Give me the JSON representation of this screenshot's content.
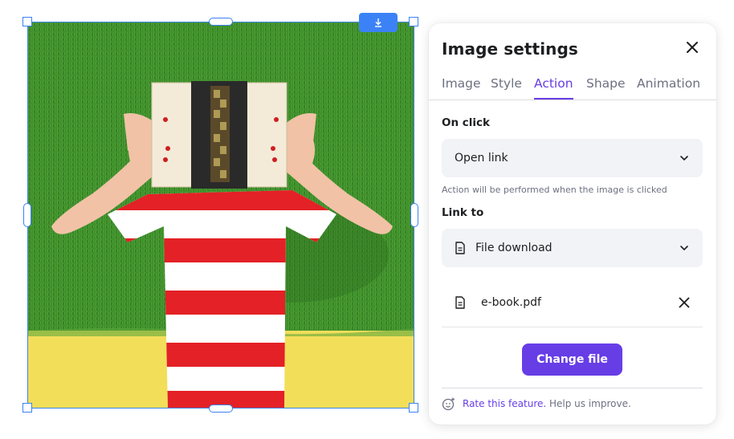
{
  "panel": {
    "title": "Image settings",
    "tabs": [
      {
        "label": "Image",
        "active": false
      },
      {
        "label": "Style",
        "active": false
      },
      {
        "label": "Action",
        "active": true
      },
      {
        "label": "Shape",
        "active": false
      },
      {
        "label": "Animation",
        "active": false
      }
    ],
    "on_click": {
      "label": "On click",
      "selected": "Open link",
      "helper": "Action will be performed when the image is clicked"
    },
    "link_to": {
      "label": "Link to",
      "selected": "File download"
    },
    "file": {
      "name": "e-book.pdf"
    },
    "change_file_label": "Change file",
    "feedback": {
      "link_text": "Rate this feature.",
      "help_text": " Help us improve."
    }
  },
  "colors": {
    "accent": "#673de6",
    "selection": "#3b82f6",
    "field_bg": "#f2f3f6",
    "muted_text": "#6d7081"
  },
  "icons": {
    "close": "close-icon",
    "chevron": "chevron-down-icon",
    "document": "document-icon",
    "download": "download-icon",
    "smiley": "smiley-plus-icon"
  }
}
